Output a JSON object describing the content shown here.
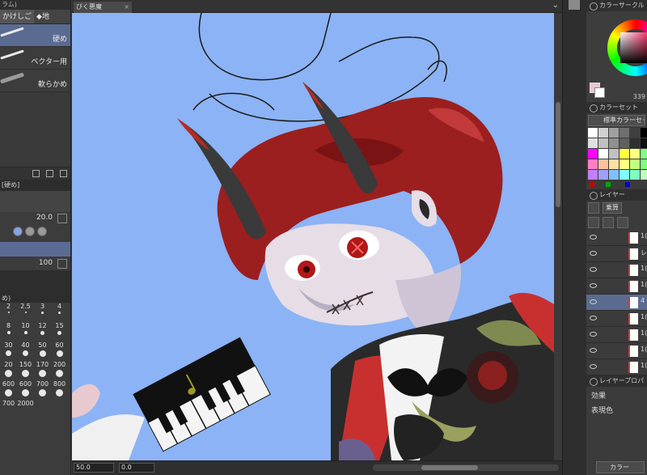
{
  "left_panel": {
    "top_label": "ラム)",
    "tabs": [
      {
        "label": "かけしご",
        "selected": true
      },
      {
        "label": "地",
        "selected": false
      }
    ],
    "brushes": [
      {
        "label": "硬め",
        "selected": true
      },
      {
        "label": "ベクター用",
        "selected": false
      },
      {
        "label": "軟らかめ",
        "selected": false
      }
    ],
    "sub_header": "[硬め]",
    "brush_size_value": "20.0",
    "opacity_value": "100",
    "size_panel_header": "め)",
    "size_presets": [
      "2",
      "2.5",
      "3",
      "4",
      "8",
      "10",
      "12",
      "15",
      "30",
      "40",
      "50",
      "60",
      "20",
      "150",
      "170",
      "200",
      "600",
      "600",
      "700",
      "800",
      "700",
      "2000",
      "",
      ""
    ]
  },
  "document": {
    "tab_title": "びく悪魔",
    "close_glyph": "×",
    "collapse_glyph": "⌄"
  },
  "status_bar": {
    "zoom": "50.0",
    "rotation": "0.0"
  },
  "right_panel": {
    "color_circle_title": "カラーサークル",
    "hsv_value": "339",
    "color_set_title": "カラーセット",
    "color_set_name": "標準カラーセット",
    "swatch_colors": [
      "#ffffff",
      "#d0d0d0",
      "#a0a0a0",
      "#707070",
      "#404040",
      "#000000",
      "#e0e0e0",
      "#c0c0c0",
      "#909090",
      "#606060",
      "#303030",
      "#101010",
      "#ff00ff",
      "#ffffff",
      "#c0c0c0",
      "#ffff40",
      "#ffff80",
      "#80ff80",
      "#ff80c0",
      "#ffc0a0",
      "#ffe0a0",
      "#ffff80",
      "#c0ff80",
      "#80ff80",
      "#c080ff",
      "#a0a0ff",
      "#80c0ff",
      "#80ffff",
      "#80ffc0",
      "#c0ffc0"
    ],
    "mini_colors": [
      "#cc0000",
      "#00aa00",
      "#0000cc"
    ],
    "layer_title": "レイヤー",
    "blend_mode": "乗算",
    "layers": [
      {
        "name": "1(",
        "selected": false
      },
      {
        "name": "レ",
        "selected": false
      },
      {
        "name": "1(",
        "selected": false
      },
      {
        "name": "1(",
        "selected": false
      },
      {
        "name": "4",
        "selected": true
      },
      {
        "name": "1(",
        "selected": false
      },
      {
        "name": "1(",
        "selected": false
      },
      {
        "name": "1(",
        "selected": false
      },
      {
        "name": "1(",
        "selected": false
      }
    ],
    "layer_property_title": "レイヤープロパ",
    "effect_label": "効果",
    "expression_color_label": "表現色",
    "color_button_label": "カラー"
  }
}
